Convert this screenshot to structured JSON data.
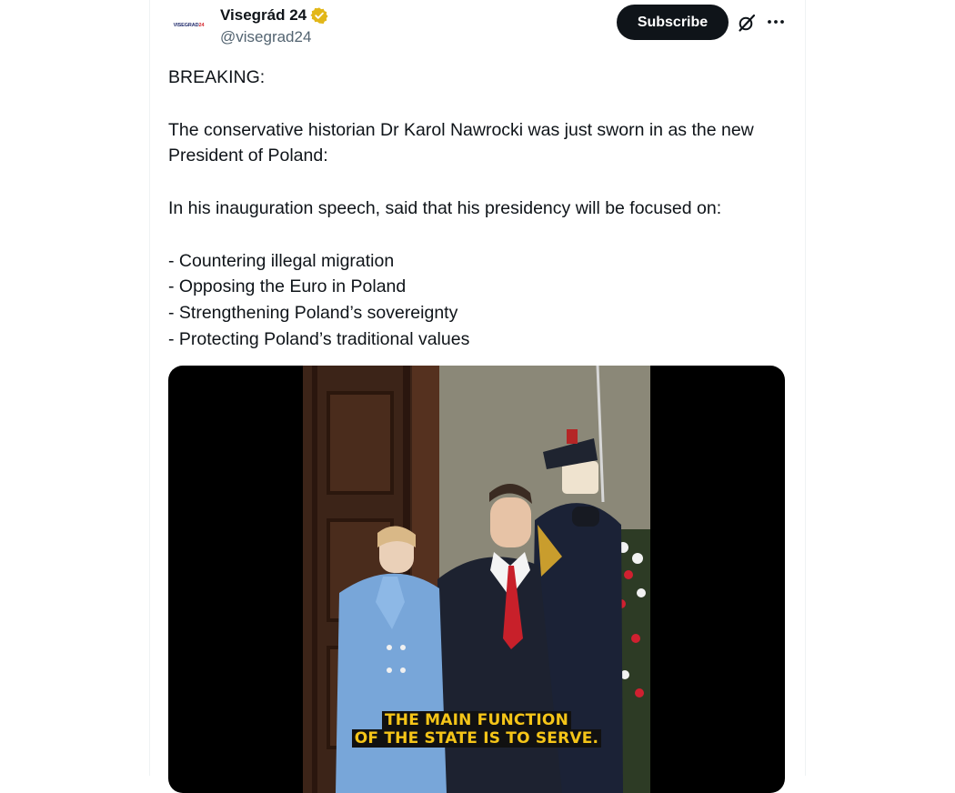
{
  "author": {
    "display_name": "Visegrád 24",
    "handle": "@visegrad24",
    "avatar_text_main": "VISEGRAD",
    "avatar_text_accent": "24",
    "verified_color": "#e2b719"
  },
  "actions": {
    "subscribe_label": "Subscribe",
    "grok_icon": "grok-icon",
    "more_icon": "more-icon"
  },
  "tweet": {
    "line_breaking": "BREAKING:",
    "paragraph_1": "The conservative historian Dr Karol Nawrocki was just sworn in as the new President of Poland:",
    "paragraph_2": "In his inauguration speech, said that his presidency will be focused on:",
    "bullets": [
      "- Countering illegal migration",
      "- Opposing the Euro in Poland",
      "- Strengthening Poland’s sovereignty",
      "- Protecting Poland’s traditional values"
    ]
  },
  "media": {
    "subtitle_line_1": "THE MAIN FUNCTION",
    "subtitle_line_2": "OF THE STATE IS TO SERVE.",
    "subtitle_color": "#f5c518"
  }
}
